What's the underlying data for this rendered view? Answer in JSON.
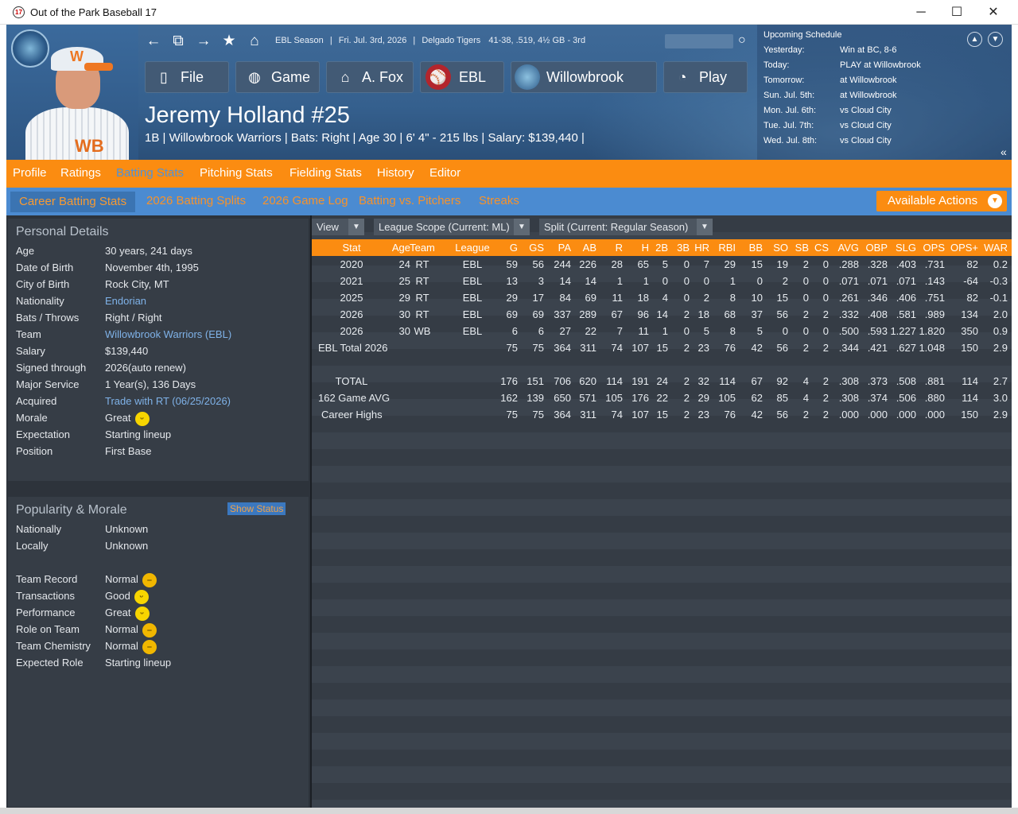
{
  "window": {
    "title": "Out of the Park Baseball 17",
    "app_icon": "17",
    "minimize": "─",
    "maximize": "☐",
    "close": "✕"
  },
  "status": {
    "season": "EBL Season",
    "date": "Fri. Jul. 3rd, 2026",
    "team": "Delgado Tigers",
    "record": "41-38, .519, 4½ GB - 3rd"
  },
  "toolbar": {
    "file": "File",
    "game": "Game",
    "manager": "A. Fox",
    "league": "EBL",
    "team": "Willowbrook",
    "play": "Play"
  },
  "player": {
    "name": "Jeremy Holland  #25",
    "info": "1B | Willowbrook Warriors  |  Bats: Right  |  Age 30  |  6' 4\" - 215 lbs  |  Salary: $139,440  |"
  },
  "schedule": {
    "title": "Upcoming Schedule",
    "rows": [
      {
        "day": "Yesterday:",
        "game": "Win at BC, 8-6"
      },
      {
        "day": "Today:",
        "game": "PLAY at Willowbrook"
      },
      {
        "day": "Tomorrow:",
        "game": "at Willowbrook"
      },
      {
        "day": "Sun. Jul. 5th:",
        "game": "at Willowbrook"
      },
      {
        "day": "Mon. Jul. 6th:",
        "game": "vs Cloud City"
      },
      {
        "day": "Tue. Jul. 7th:",
        "game": "vs Cloud City"
      },
      {
        "day": "Wed. Jul. 8th:",
        "game": "vs Cloud City"
      }
    ]
  },
  "tabs": [
    "Profile",
    "Ratings",
    "Batting Stats",
    "Pitching Stats",
    "Fielding Stats",
    "History",
    "Editor"
  ],
  "subtabs": [
    "Career Batting Stats",
    "2026 Batting Splits",
    "2026 Game Log",
    "Batting vs. Pitchers",
    "Streaks"
  ],
  "actions_label": "Available Actions",
  "personal": {
    "title": "Personal Details",
    "rows": [
      {
        "k": "Age",
        "v": "30 years, 241 days"
      },
      {
        "k": "Date of Birth",
        "v": "November 4th, 1995"
      },
      {
        "k": "City of Birth",
        "v": "Rock City, MT"
      },
      {
        "k": "Nationality",
        "v": "Endorian"
      },
      {
        "k": "Bats / Throws",
        "v": "Right / Right"
      },
      {
        "k": "Team",
        "v": "Willowbrook Warriors (EBL)"
      },
      {
        "k": "Salary",
        "v": "$139,440"
      },
      {
        "k": "Signed through",
        "v": "2026(auto renew)"
      },
      {
        "k": "Major Service",
        "v": "1 Year(s), 136 Days"
      },
      {
        "k": "Acquired",
        "v": "Trade with RT (06/25/2026)"
      },
      {
        "k": "Morale",
        "v": "Great"
      },
      {
        "k": "Expectation",
        "v": "Starting lineup"
      },
      {
        "k": "Position",
        "v": "First Base"
      }
    ]
  },
  "popularity": {
    "title": "Popularity & Morale",
    "show_status": "Show Status",
    "rows": [
      {
        "k": "Nationally",
        "v": "Unknown"
      },
      {
        "k": "Locally",
        "v": "Unknown"
      },
      {
        "k": "Team Record",
        "v": "Normal"
      },
      {
        "k": "Transactions",
        "v": "Good"
      },
      {
        "k": "Performance",
        "v": "Great"
      },
      {
        "k": "Role on Team",
        "v": "Normal"
      },
      {
        "k": "Team Chemistry",
        "v": "Normal"
      },
      {
        "k": "Expected Role",
        "v": "Starting lineup"
      }
    ]
  },
  "filters": {
    "view": "View",
    "scope": "League Scope  (Current: ML)",
    "split": "Split  (Current: Regular Season)"
  },
  "stats": {
    "headers": [
      "Stat",
      "Age",
      "Team",
      "League",
      "G",
      "GS",
      "PA",
      "AB",
      "R",
      "H",
      "2B",
      "3B",
      "HR",
      "RBI",
      "BB",
      "SO",
      "SB",
      "CS",
      "AVG",
      "OBP",
      "SLG",
      "OPS",
      "OPS+",
      "WAR"
    ],
    "rows": [
      [
        "2020",
        "24",
        "RT",
        "EBL",
        "59",
        "56",
        "244",
        "226",
        "28",
        "65",
        "5",
        "0",
        "7",
        "29",
        "15",
        "19",
        "2",
        "0",
        ".288",
        ".328",
        ".403",
        ".731",
        "82",
        "0.2"
      ],
      [
        "2021",
        "25",
        "RT",
        "EBL",
        "13",
        "3",
        "14",
        "14",
        "1",
        "1",
        "0",
        "0",
        "0",
        "1",
        "0",
        "2",
        "0",
        "0",
        ".071",
        ".071",
        ".071",
        ".143",
        "-64",
        "-0.3"
      ],
      [
        "2025",
        "29",
        "RT",
        "EBL",
        "29",
        "17",
        "84",
        "69",
        "11",
        "18",
        "4",
        "0",
        "2",
        "8",
        "10",
        "15",
        "0",
        "0",
        ".261",
        ".346",
        ".406",
        ".751",
        "82",
        "-0.1"
      ],
      [
        "2026",
        "30",
        "RT",
        "EBL",
        "69",
        "69",
        "337",
        "289",
        "67",
        "96",
        "14",
        "2",
        "18",
        "68",
        "37",
        "56",
        "2",
        "2",
        ".332",
        ".408",
        ".581",
        ".989",
        "134",
        "2.0"
      ],
      [
        "2026",
        "30",
        "WB",
        "EBL",
        "6",
        "6",
        "27",
        "22",
        "7",
        "11",
        "1",
        "0",
        "5",
        "8",
        "5",
        "0",
        "0",
        "0",
        ".500",
        ".593",
        "1.227",
        "1.820",
        "350",
        "0.9"
      ],
      [
        "EBL Total 2026",
        "",
        "",
        "",
        "75",
        "75",
        "364",
        "311",
        "74",
        "107",
        "15",
        "2",
        "23",
        "76",
        "42",
        "56",
        "2",
        "2",
        ".344",
        ".421",
        ".627",
        "1.048",
        "150",
        "2.9"
      ],
      [
        "",
        "",
        "",
        "",
        "",
        "",
        "",
        "",
        "",
        "",
        "",
        "",
        "",
        "",
        "",
        "",
        "",
        "",
        "",
        "",
        "",
        "",
        "",
        ""
      ],
      [
        "TOTAL",
        "",
        "",
        "",
        "176",
        "151",
        "706",
        "620",
        "114",
        "191",
        "24",
        "2",
        "32",
        "114",
        "67",
        "92",
        "4",
        "2",
        ".308",
        ".373",
        ".508",
        ".881",
        "114",
        "2.7"
      ],
      [
        "162 Game AVG",
        "",
        "",
        "",
        "162",
        "139",
        "650",
        "571",
        "105",
        "176",
        "22",
        "2",
        "29",
        "105",
        "62",
        "85",
        "4",
        "2",
        ".308",
        ".374",
        ".506",
        ".880",
        "114",
        "3.0"
      ],
      [
        "Career Highs",
        "",
        "",
        "",
        "75",
        "75",
        "364",
        "311",
        "74",
        "107",
        "15",
        "2",
        "23",
        "76",
        "42",
        "56",
        "2",
        "2",
        ".000",
        ".000",
        ".000",
        ".000",
        "150",
        "2.9"
      ]
    ]
  }
}
